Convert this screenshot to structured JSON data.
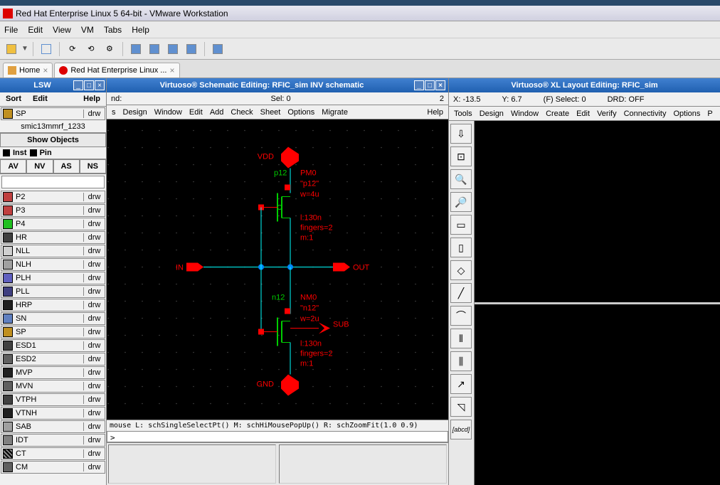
{
  "vmware": {
    "title": "Red Hat Enterprise Linux 5 64-bit - VMware Workstation",
    "menu": [
      "File",
      "Edit",
      "View",
      "VM",
      "Tabs",
      "Help"
    ],
    "tabs": [
      {
        "label": "Home"
      },
      {
        "label": "Red Hat Enterprise Linux ..."
      }
    ]
  },
  "lsw": {
    "title": "LSW",
    "menu": [
      "Sort",
      "Edit",
      "Help"
    ],
    "current_layer": {
      "name": "SP",
      "purpose": "drw"
    },
    "library": "smic13mmrf_1233",
    "show_objects": "Show Objects",
    "inst": "Inst",
    "pin": "Pin",
    "buttons": [
      "AV",
      "NV",
      "AS",
      "NS"
    ],
    "filter": "",
    "layers": [
      {
        "name": "P2",
        "purpose": "drw",
        "swatch": "c-p2"
      },
      {
        "name": "P3",
        "purpose": "drw",
        "swatch": "c-p3"
      },
      {
        "name": "P4",
        "purpose": "drw",
        "swatch": "c-p4"
      },
      {
        "name": "HR",
        "purpose": "drw",
        "swatch": "c-hr"
      },
      {
        "name": "NLL",
        "purpose": "drw",
        "swatch": "c-nll"
      },
      {
        "name": "NLH",
        "purpose": "drw",
        "swatch": "c-nlh"
      },
      {
        "name": "PLH",
        "purpose": "drw",
        "swatch": "c-plh"
      },
      {
        "name": "PLL",
        "purpose": "drw",
        "swatch": "c-pll"
      },
      {
        "name": "HRP",
        "purpose": "drw",
        "swatch": "c-hrp"
      },
      {
        "name": "SN",
        "purpose": "drw",
        "swatch": "c-sn"
      },
      {
        "name": "SP",
        "purpose": "drw",
        "swatch": "c-sp"
      },
      {
        "name": "ESD1",
        "purpose": "drw",
        "swatch": "c-esd1"
      },
      {
        "name": "ESD2",
        "purpose": "drw",
        "swatch": "c-esd2"
      },
      {
        "name": "MVP",
        "purpose": "drw",
        "swatch": "c-mvp"
      },
      {
        "name": "MVN",
        "purpose": "drw",
        "swatch": "c-mvn"
      },
      {
        "name": "VTPH",
        "purpose": "drw",
        "swatch": "c-vtph"
      },
      {
        "name": "VTNH",
        "purpose": "drw",
        "swatch": "c-vtnh"
      },
      {
        "name": "SAB",
        "purpose": "drw",
        "swatch": "c-sab"
      },
      {
        "name": "IDT",
        "purpose": "drw",
        "swatch": "c-idt"
      },
      {
        "name": "CT",
        "purpose": "drw",
        "swatch": "c-ct"
      },
      {
        "name": "CM",
        "purpose": "drw",
        "swatch": "c-cm"
      }
    ]
  },
  "schematic": {
    "title": "Virtuoso® Schematic Editing: RFIC_sim INV schematic",
    "cmd_status": "nd:",
    "sel": "Sel: 0",
    "err_count": "2",
    "menu": [
      "s",
      "Design",
      "Window",
      "Edit",
      "Add",
      "Check",
      "Sheet",
      "Options",
      "Migrate"
    ],
    "help": "Help",
    "nets": {
      "vdd": "VDD",
      "gnd": "GND",
      "in": "IN",
      "out": "OUT",
      "sub": "SUB"
    },
    "pmos": {
      "inst": "p12",
      "name": "PM0",
      "label": "\"p12\"",
      "w": "w=4u",
      "l": "l:130n",
      "fingers": "fingers=2",
      "m": "m:1"
    },
    "nmos": {
      "inst": "n12",
      "name": "NM0",
      "label": "\"n12\"",
      "w": "w=2u",
      "l": "l:130n",
      "fingers": "fingers=2",
      "m": "m:1"
    },
    "mouse": "mouse L: schSingleSelectPt() M: schHiMousePopUp()   R: schZoomFit(1.0 0.9)",
    "prompt": ">"
  },
  "layout": {
    "title": "Virtuoso® XL Layout Editing: RFIC_sim",
    "x": "X: -13.5",
    "y": "Y: 6.7",
    "sel": "(F) Select: 0",
    "drd": "DRD: OFF",
    "menu": [
      "Tools",
      "Design",
      "Window",
      "Create",
      "Edit",
      "Verify",
      "Connectivity",
      "Options",
      "P"
    ]
  }
}
